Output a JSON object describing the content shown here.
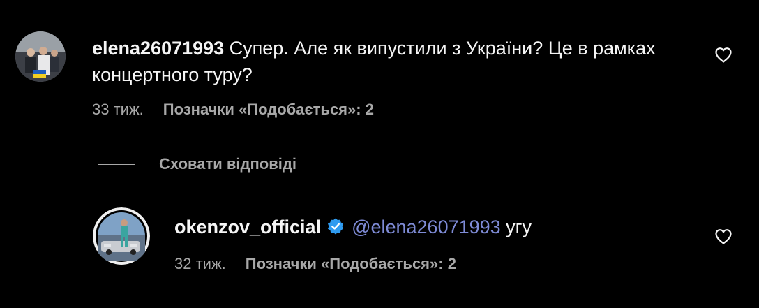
{
  "comment": {
    "username": "elena26071993",
    "text": " Супер. Але як випустили з України? Це в рамках концертного туру?",
    "time": "33 тиж.",
    "likes": "Позначки «Подобається»: 2"
  },
  "hide_replies_label": "Сховати відповіді",
  "reply": {
    "username": "okenzov_official",
    "mention": "@elena26071993",
    "text": " угу",
    "time": "32 тиж.",
    "likes": "Позначки «Подобається»: 2"
  },
  "colors": {
    "background": "#000000",
    "text": "#f5f5f5",
    "secondary": "#a8a8a8",
    "mention": "#7e8bd6",
    "verified": "#2f9bf0"
  },
  "icons": {
    "like": "heart-outline-icon",
    "verified": "verified-badge-icon"
  }
}
